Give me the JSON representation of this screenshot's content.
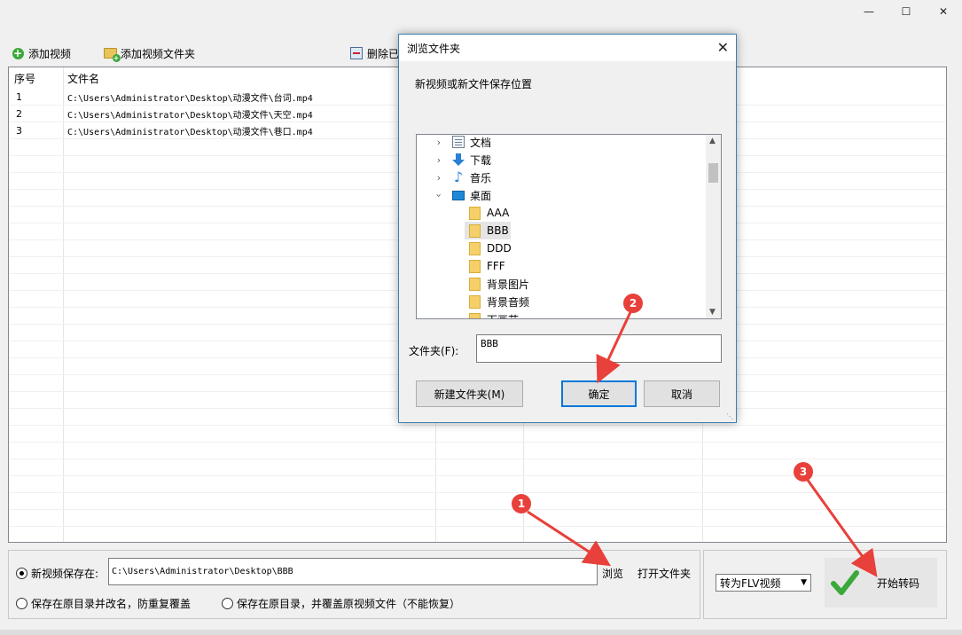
{
  "window": {
    "minimize_icon": "—",
    "maximize_icon": "☐",
    "close_icon": "✕"
  },
  "toolbar": {
    "add_video": "添加视频",
    "add_folder": "添加视频文件夹",
    "delete_label": "删除已"
  },
  "table": {
    "headers": {
      "seq": "序号",
      "name": "文件名"
    },
    "rows": [
      {
        "seq": "1",
        "name": "C:\\Users\\Administrator\\Desktop\\动漫文件\\台词.mp4"
      },
      {
        "seq": "2",
        "name": "C:\\Users\\Administrator\\Desktop\\动漫文件\\天空.mp4"
      },
      {
        "seq": "3",
        "name": "C:\\Users\\Administrator\\Desktop\\动漫文件\\巷口.mp4"
      }
    ]
  },
  "output": {
    "save_new_label": "新视频保存在:",
    "save_path": "C:\\Users\\Administrator\\Desktop\\BBB",
    "browse": "浏览",
    "open_folder": "打开文件夹",
    "save_rename": "保存在原目录并改名，防重复覆盖",
    "save_overwrite": "保存在原目录，并覆盖原视频文件（不能恢复）"
  },
  "convert": {
    "format_selected": "转为FLV视频",
    "start": "开始转码"
  },
  "dialog": {
    "title": "浏览文件夹",
    "close_icon": "✕",
    "description": "新视频或新文件保存位置",
    "tree": {
      "documents": "文档",
      "downloads": "下载",
      "music": "音乐",
      "desktop": "桌面",
      "folders": [
        "AAA",
        "BBB",
        "DDD",
        "FFF",
        "背景图片",
        "背景音频",
        "下画节"
      ]
    },
    "folder_label": "文件夹(F):",
    "folder_value": "BBB",
    "new_folder": "新建文件夹(M)",
    "ok": "确定",
    "cancel": "取消"
  },
  "badges": {
    "one": "1",
    "two": "2",
    "three": "3"
  },
  "colors": {
    "accent": "#0078d7",
    "badge": "#e8403a",
    "check": "#3aa83a"
  }
}
